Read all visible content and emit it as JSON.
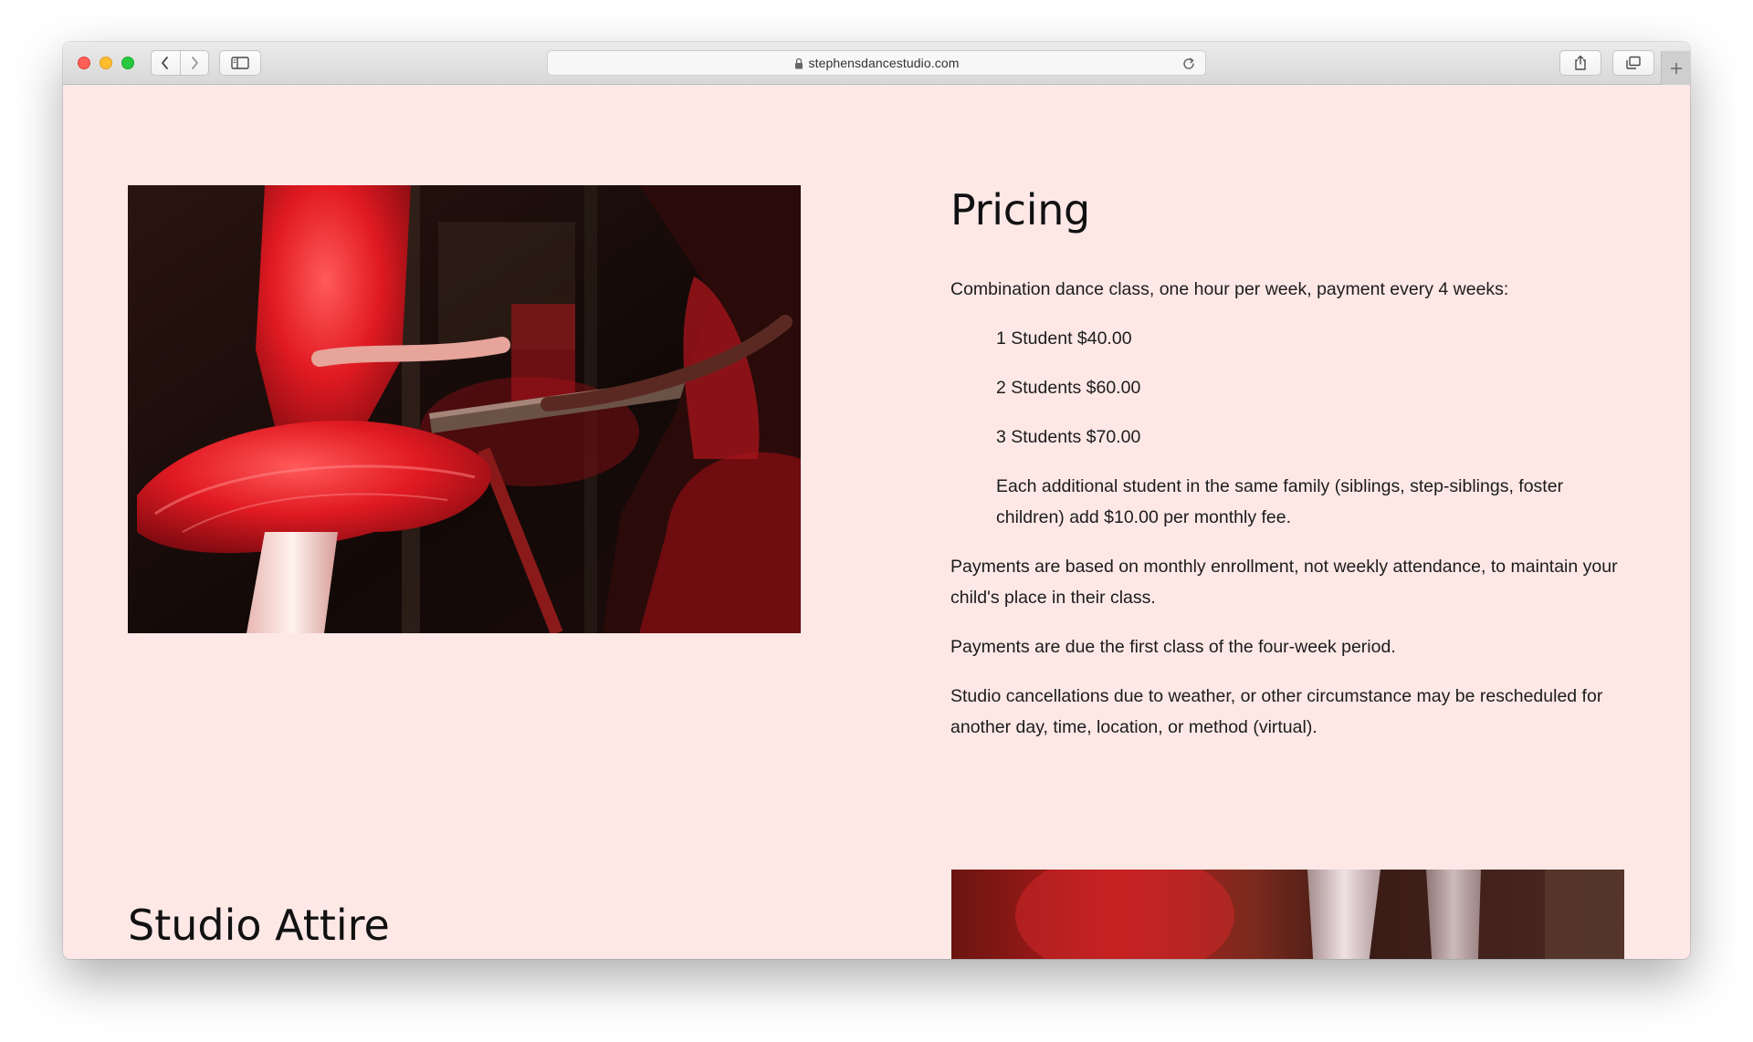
{
  "browser": {
    "url": "stephensdancestudio.com"
  },
  "pricing": {
    "title": "Pricing",
    "intro": "Combination dance class, one hour per week, payment every 4 weeks:",
    "tiers": [
      "1 Student $40.00",
      "2 Students $60.00",
      "3 Students $70.00"
    ],
    "additional_note": "Each additional student in the same family (siblings, step-siblings, foster children) add $10.00 per monthly fee.",
    "paragraphs": [
      "Payments are based on monthly enrollment, not weekly attendance, to maintain your child's place in their class.",
      "Payments are due the first class of the four-week period.",
      "Studio cancellations due to weather, or other circumstance may be rescheduled for another day, time, location, or method (virtual)."
    ]
  },
  "attire": {
    "title": "Studio Attire"
  },
  "colors": {
    "page_background": "#fde8e6",
    "heading": "#111111",
    "body_text": "#1c1c1c",
    "tutu_red": "#e11a22"
  }
}
